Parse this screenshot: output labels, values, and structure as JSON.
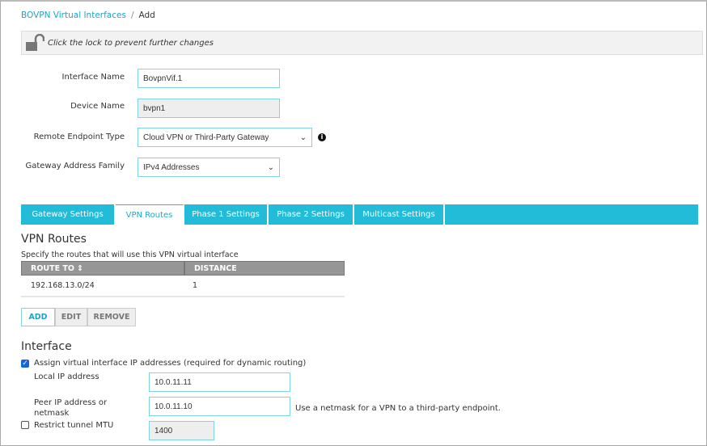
{
  "breadcrumb": {
    "parent": "BOVPN Virtual Interfaces",
    "separator": "/",
    "current": "Add"
  },
  "lock": {
    "icon": "unlocked-padlock-icon",
    "message": "Click the lock to prevent further changes"
  },
  "form": {
    "interface_name": {
      "label": "Interface Name",
      "value": "BovpnVif.1"
    },
    "device_name": {
      "label": "Device Name",
      "value": "bvpn1"
    },
    "remote_endpoint_type": {
      "label": "Remote Endpoint Type",
      "value": "Cloud VPN or Third-Party Gateway"
    },
    "gateway_address_family": {
      "label": "Gateway Address Family",
      "value": "IPv4 Addresses"
    }
  },
  "tabs": [
    {
      "label": "Gateway Settings",
      "active": false
    },
    {
      "label": "VPN Routes",
      "active": true
    },
    {
      "label": "Phase 1 Settings",
      "active": false
    },
    {
      "label": "Phase 2 Settings",
      "active": false
    },
    {
      "label": "Multicast Settings",
      "active": false
    }
  ],
  "vpn_routes": {
    "heading": "VPN Routes",
    "description": "Specify the routes that will use this VPN virtual interface",
    "columns": [
      "ROUTE TO",
      "DISTANCE"
    ],
    "rows": [
      {
        "route_to": "192.168.13.0/24",
        "distance": "1"
      }
    ],
    "buttons": {
      "add": "ADD",
      "edit": "EDIT",
      "remove": "REMOVE"
    }
  },
  "interface": {
    "heading": "Interface",
    "assign_label": "Assign virtual interface IP addresses (required for dynamic routing)",
    "assign_checked": true,
    "local_ip": {
      "label": "Local IP address",
      "value": "10.0.11.11"
    },
    "peer_ip": {
      "label_line1": "Peer IP address or",
      "label_line2": "netmask",
      "value": "10.0.11.10",
      "hint": "Use a netmask for a VPN to a third-party endpoint."
    },
    "restrict_mtu": {
      "label": "Restrict tunnel MTU",
      "checked": false,
      "value": "1400"
    }
  },
  "colors": {
    "accent": "#22bbd8",
    "link": "#1fa3c7",
    "header": "#969696"
  }
}
